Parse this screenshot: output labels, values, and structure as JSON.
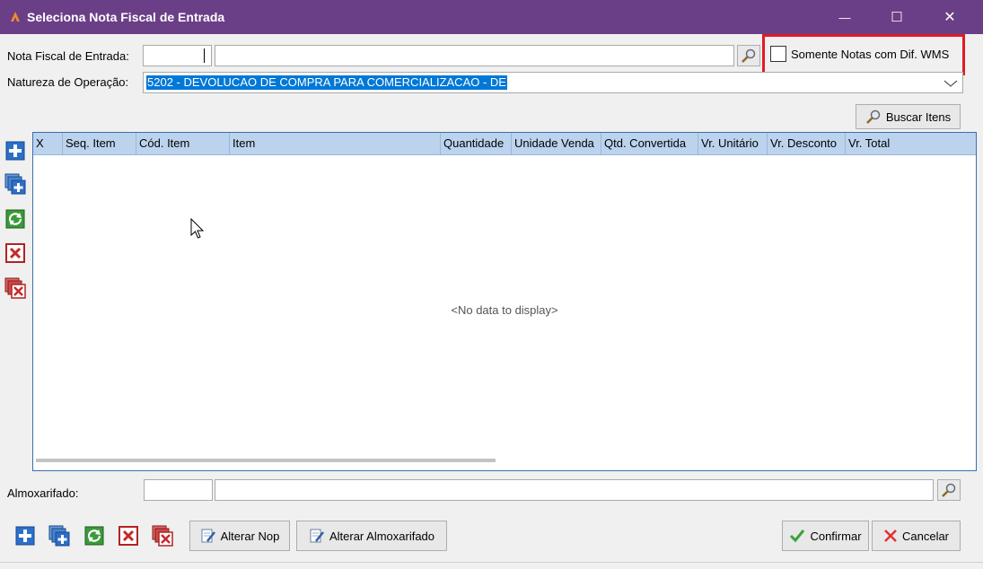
{
  "window": {
    "title": "Seleciona Nota Fiscal de Entrada",
    "minimize_glyph": "—",
    "maximize_glyph": "☐",
    "close_glyph": "✕"
  },
  "form": {
    "nota_label": "Nota Fiscal de Entrada:",
    "nota_number_value": "",
    "nota_desc_value": "",
    "natureza_label": "Natureza de Operação:",
    "natureza_value": "5202 - DEVOLUCAO DE  COMPRA PARA COMERCIALIZACAO - DE",
    "checkbox_label": "Somente Notas com Dif. WMS",
    "checkbox_checked": false,
    "buscar_label": "Buscar Itens",
    "almox_label": "Almoxarifado:",
    "almox_code_value": "",
    "almox_desc_value": ""
  },
  "grid": {
    "columns": [
      "X",
      "Seq. Item",
      "Cód. Item",
      "Item",
      "Quantidade",
      "Unidade Venda",
      "Qtd. Convertida",
      "Vr. Unitário",
      "Vr. Desconto",
      "Vr. Total"
    ],
    "empty_text": "<No data to display>"
  },
  "toolbar": {
    "alterar_nop": "Alterar Nop",
    "alterar_almox": "Alterar Almoxarifado",
    "confirmar": "Confirmar",
    "cancelar": "Cancelar"
  },
  "colors": {
    "titlebar": "#6b3f87",
    "highlight": "#e01b24",
    "selection": "#0078d7",
    "grid_header": "#bcd3ee"
  },
  "icons": [
    "add-icon",
    "add-multiple-icon",
    "refresh-icon",
    "delete-icon",
    "delete-multiple-icon",
    "search-icon",
    "edit-icon",
    "check-icon",
    "cancel-icon"
  ]
}
